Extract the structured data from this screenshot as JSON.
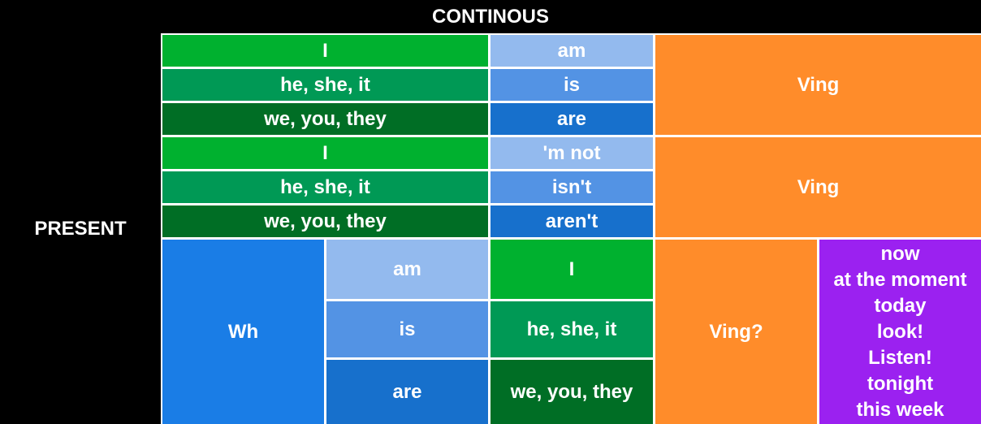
{
  "title": "CONTINOUS",
  "side_label": "PRESENT",
  "affirmative": {
    "subjects": [
      "I",
      "he, she, it",
      "we, you, they"
    ],
    "verbs": [
      "am",
      "is",
      "are"
    ],
    "ending": "Ving"
  },
  "negative": {
    "subjects": [
      "I",
      "he, she, it",
      "we, you, they"
    ],
    "verbs": [
      "'m not",
      "isn't",
      "aren't"
    ],
    "ending": "Ving"
  },
  "question": {
    "wh": "Wh",
    "verbs": [
      "am",
      "is",
      "are"
    ],
    "subjects": [
      "I",
      "he, she, it",
      "we, you, they"
    ],
    "ending": "Ving?",
    "time_markers": [
      "now",
      "at the moment",
      "today",
      "look!",
      "Listen!",
      "tonight",
      "this week"
    ]
  },
  "colors": {
    "background": "#000000",
    "green_light": "#00b12f",
    "green_mid": "#009955",
    "green_dark": "#006e25",
    "blue_light": "#93baee",
    "blue_mid": "#5393e4",
    "blue_dark": "#1770cc",
    "blue_wh": "#1a7de6",
    "orange": "#ff8c2a",
    "purple": "#9b21f0"
  }
}
